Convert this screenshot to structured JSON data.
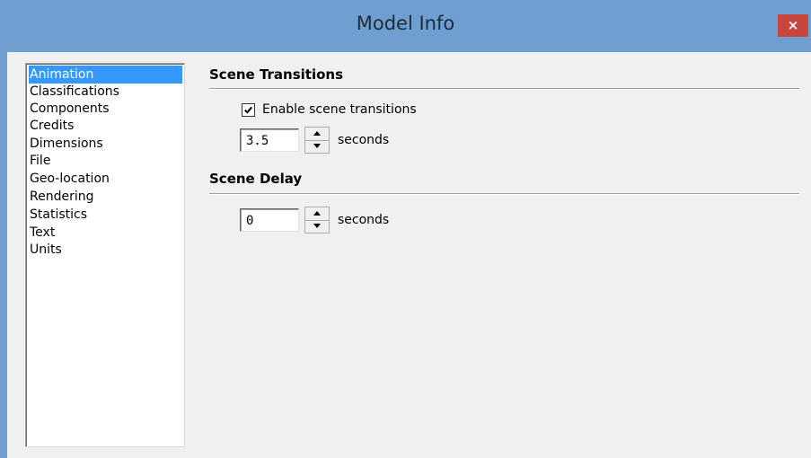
{
  "window": {
    "title": "Model Info",
    "close_glyph": "×"
  },
  "sidebar": {
    "items": [
      {
        "label": "Animation",
        "selected": true
      },
      {
        "label": "Classifications",
        "selected": false
      },
      {
        "label": "Components",
        "selected": false
      },
      {
        "label": "Credits",
        "selected": false
      },
      {
        "label": "Dimensions",
        "selected": false
      },
      {
        "label": "File",
        "selected": false
      },
      {
        "label": "Geo-location",
        "selected": false
      },
      {
        "label": "Rendering",
        "selected": false
      },
      {
        "label": "Statistics",
        "selected": false
      },
      {
        "label": "Text",
        "selected": false
      },
      {
        "label": "Units",
        "selected": false
      }
    ]
  },
  "scene_transitions": {
    "title": "Scene Transitions",
    "enable_checkbox": {
      "label": "Enable scene transitions",
      "checked": true
    },
    "duration_value": "3.5",
    "duration_unit": "seconds"
  },
  "scene_delay": {
    "title": "Scene Delay",
    "delay_value": "0",
    "delay_unit": "seconds"
  },
  "colors": {
    "title_bar": "#6f9fd0",
    "close_button": "#c9463e",
    "selection": "#3399ff",
    "dialog_background": "#f0f0f0"
  }
}
